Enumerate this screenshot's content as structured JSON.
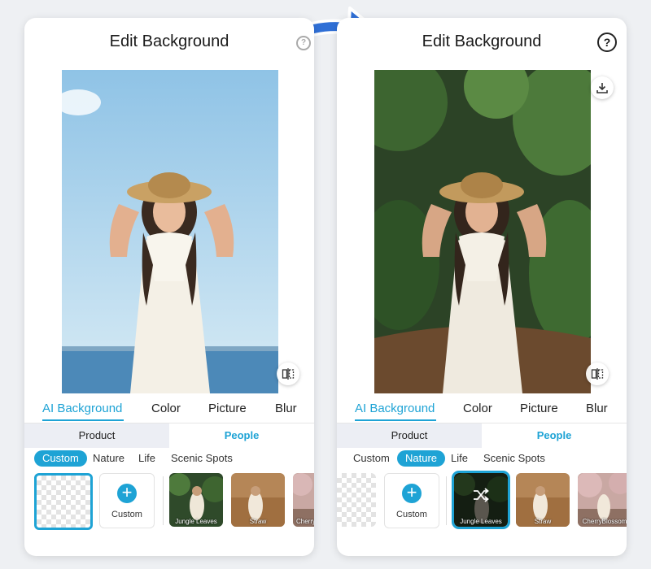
{
  "colors": {
    "accent": "#1ea3d5",
    "background": "#eef0f3",
    "panel": "#ffffff"
  },
  "before": {
    "title": "Edit Background",
    "tabs": [
      "AI Background",
      "Color",
      "Picture",
      "Blur"
    ],
    "active_tab": "AI Background",
    "segments": [
      "Product",
      "People"
    ],
    "active_segment": "People",
    "chips": [
      "Custom",
      "Nature",
      "Life",
      "Scenic Spots"
    ],
    "active_chip": "Custom",
    "custom_label": "Custom",
    "thumbnails": [
      "Jungle Leaves",
      "Straw",
      "Cherry"
    ],
    "icons": [
      "compare-icon",
      "plus-icon"
    ]
  },
  "after": {
    "title": "Edit Background",
    "help": "?",
    "tabs": [
      "AI Background",
      "Color",
      "Picture",
      "Blur"
    ],
    "active_tab": "AI Background",
    "segments": [
      "Product",
      "People"
    ],
    "active_segment": "People",
    "chips": [
      "Custom",
      "Nature",
      "Life",
      "Scenic Spots"
    ],
    "active_chip": "Nature",
    "custom_label": "Custom",
    "thumbnails": [
      "Jungle Leaves",
      "Straw",
      "CherryBlossom"
    ],
    "selected_thumbnail": "Jungle Leaves",
    "icons": [
      "download-icon",
      "compare-icon",
      "plus-icon",
      "shuffle-icon"
    ]
  }
}
